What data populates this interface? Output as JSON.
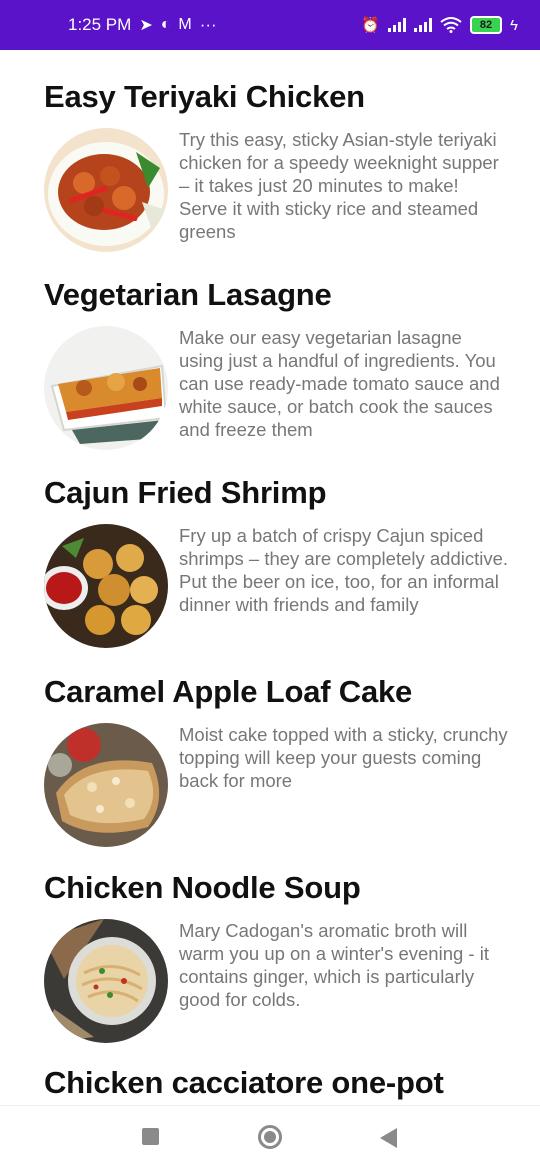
{
  "status_bar": {
    "time": "1:25 PM",
    "dots": "···",
    "battery": "82",
    "background": "#5a13c8"
  },
  "recipes": [
    {
      "title": "Easy Teriyaki Chicken",
      "description": "Try this easy, sticky Asian-style teriyaki chicken for a speedy weeknight supper – it takes just 20 minutes to make! Serve it with sticky rice and steamed greens",
      "image": "teriyaki-chicken-photo"
    },
    {
      "title": "Vegetarian Lasagne",
      "description": "Make our easy vegetarian lasagne using just a handful of ingredients. You can use ready-made tomato sauce and white sauce, or batch cook the sauces and freeze them",
      "image": "vegetarian-lasagne-photo"
    },
    {
      "title": "Cajun Fried Shrimp",
      "description": "Fry up a batch of crispy Cajun spiced shrimps – they are completely addictive. Put the beer on ice, too, for an informal dinner with friends and family",
      "image": "cajun-shrimp-photo"
    },
    {
      "title": "Caramel Apple Loaf Cake",
      "description": "Moist cake topped with a sticky, crunchy topping will keep your guests coming back for more",
      "image": "apple-loaf-cake-photo"
    },
    {
      "title": "Chicken Noodle Soup",
      "description": "Mary Cadogan's aromatic broth will warm you up on a winter's evening - it contains ginger, which is particularly good for colds.",
      "image": "noodle-soup-photo"
    },
    {
      "title": "Chicken cacciatore one-pot",
      "description": "",
      "image": "cacciatore-photo"
    }
  ]
}
